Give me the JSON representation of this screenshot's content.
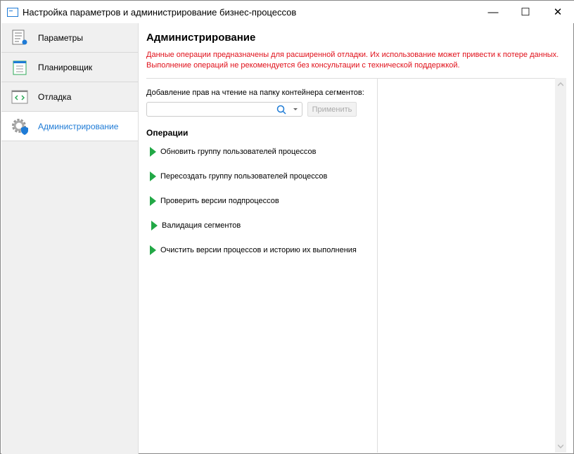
{
  "window": {
    "title": "Настройка параметров и администрирование бизнес-процессов",
    "minimize": "—",
    "maximize": "☐",
    "close": "✕"
  },
  "sidebar": {
    "items": [
      {
        "label": "Параметры",
        "icon": "settings-list-icon"
      },
      {
        "label": "Планировщик",
        "icon": "calendar-icon"
      },
      {
        "label": "Отладка",
        "icon": "code-icon"
      },
      {
        "label": "Администрирование",
        "icon": "gear-shield-icon",
        "active": true
      }
    ]
  },
  "main": {
    "title": "Администрирование",
    "warning": [
      "Данные операции предназначены для расширенной отладки. Их использование может привести к потере данных.",
      "Выполнение операций не рекомендуется без консультации с технической поддержкой."
    ],
    "folder_label": "Добавление прав на чтение на папку контейнера сегментов:",
    "folder_value": "",
    "apply_label": "Применить",
    "operations_title": "Операции",
    "operations": [
      "Обновить группу пользователей процессов",
      "Пересоздать группу пользователей процессов",
      "Проверить версии подпроцессов",
      "Валидация сегментов",
      "Очистить версии процессов и историю их выполнения"
    ]
  },
  "colors": {
    "accent": "#1e7bd6",
    "warning": "#e0101a",
    "run": "#22a846"
  }
}
